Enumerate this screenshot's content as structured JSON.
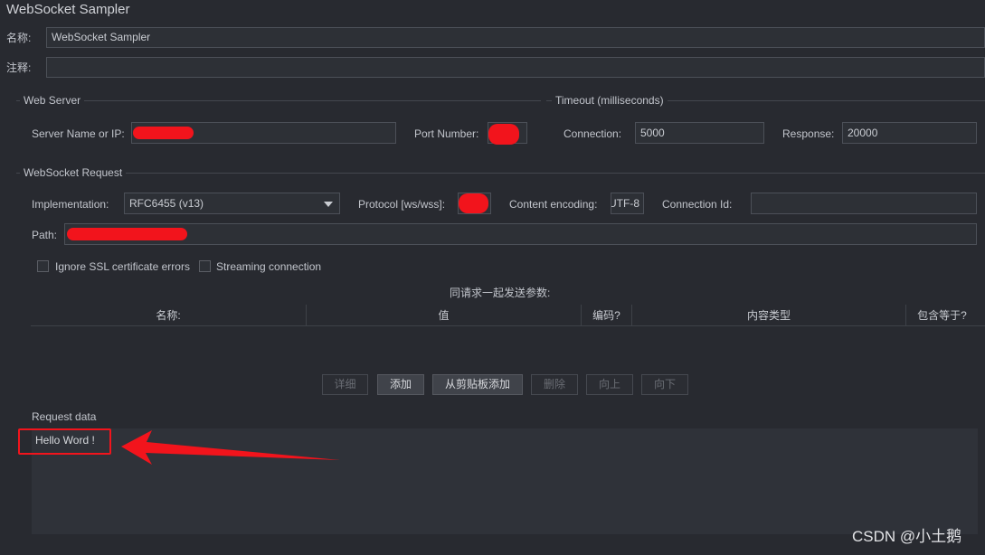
{
  "window": {
    "title": "WebSocket Sampler"
  },
  "name_field": {
    "label": "名称:",
    "value": "WebSocket Sampler"
  },
  "comment_field": {
    "label": "注释:",
    "value": ""
  },
  "web_server": {
    "legend": "Web Server",
    "server_label": "Server Name or IP:",
    "port_label": "Port Number:"
  },
  "timeout": {
    "legend": "Timeout (milliseconds)",
    "connection_label": "Connection:",
    "connection_value": "5000",
    "response_label": "Response:",
    "response_value": "20000"
  },
  "ws_request": {
    "legend": "WebSocket Request",
    "implementation_label": "Implementation:",
    "implementation_value": "RFC6455 (v13)",
    "protocol_label": "Protocol [ws/wss]:",
    "encoding_label": "Content encoding:",
    "encoding_value": "UTF-8",
    "connection_id_label": "Connection Id:",
    "connection_id_value": "",
    "path_label": "Path:",
    "ignore_ssl_label": "Ignore SSL certificate errors",
    "streaming_label": "Streaming connection"
  },
  "params": {
    "caption": "同请求一起发送参数:",
    "columns": [
      "名称:",
      "值",
      "编码?",
      "内容类型",
      "包含等于?"
    ]
  },
  "buttons": {
    "detail": "详细",
    "add": "添加",
    "add_clipboard": "从剪贴板添加",
    "delete": "删除",
    "up": "向上",
    "down": "向下"
  },
  "request_data": {
    "label": "Request data",
    "value": "Hello Word !"
  },
  "watermark": "CSDN @小土鹅",
  "colors": {
    "annotation_red": "#f2141c",
    "background": "#282a30"
  }
}
